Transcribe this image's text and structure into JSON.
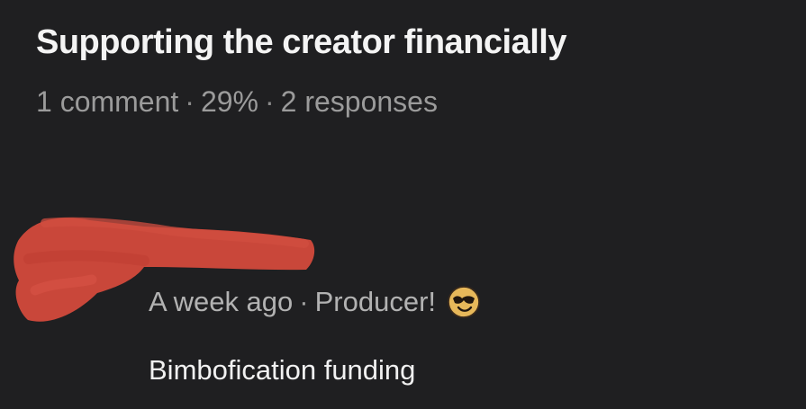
{
  "post": {
    "title": "Supporting the creator financially",
    "stats": {
      "comments": "1 comment",
      "separator": "·",
      "percent": "29%",
      "responses": "2 responses"
    }
  },
  "comment": {
    "timestamp": "A week ago",
    "separator": "·",
    "author_label": "Producer!",
    "author_emoji": "smiling-face-with-sunglasses",
    "text": "Bimbofication funding"
  },
  "colors": {
    "background": "#1f1f21",
    "title": "#f4f4f4",
    "meta": "#9b9b9b",
    "comment_meta": "#b2b2b2",
    "comment_text": "#f1f1f1",
    "redaction": "#c9473a",
    "emoji": "#e7b85a"
  }
}
